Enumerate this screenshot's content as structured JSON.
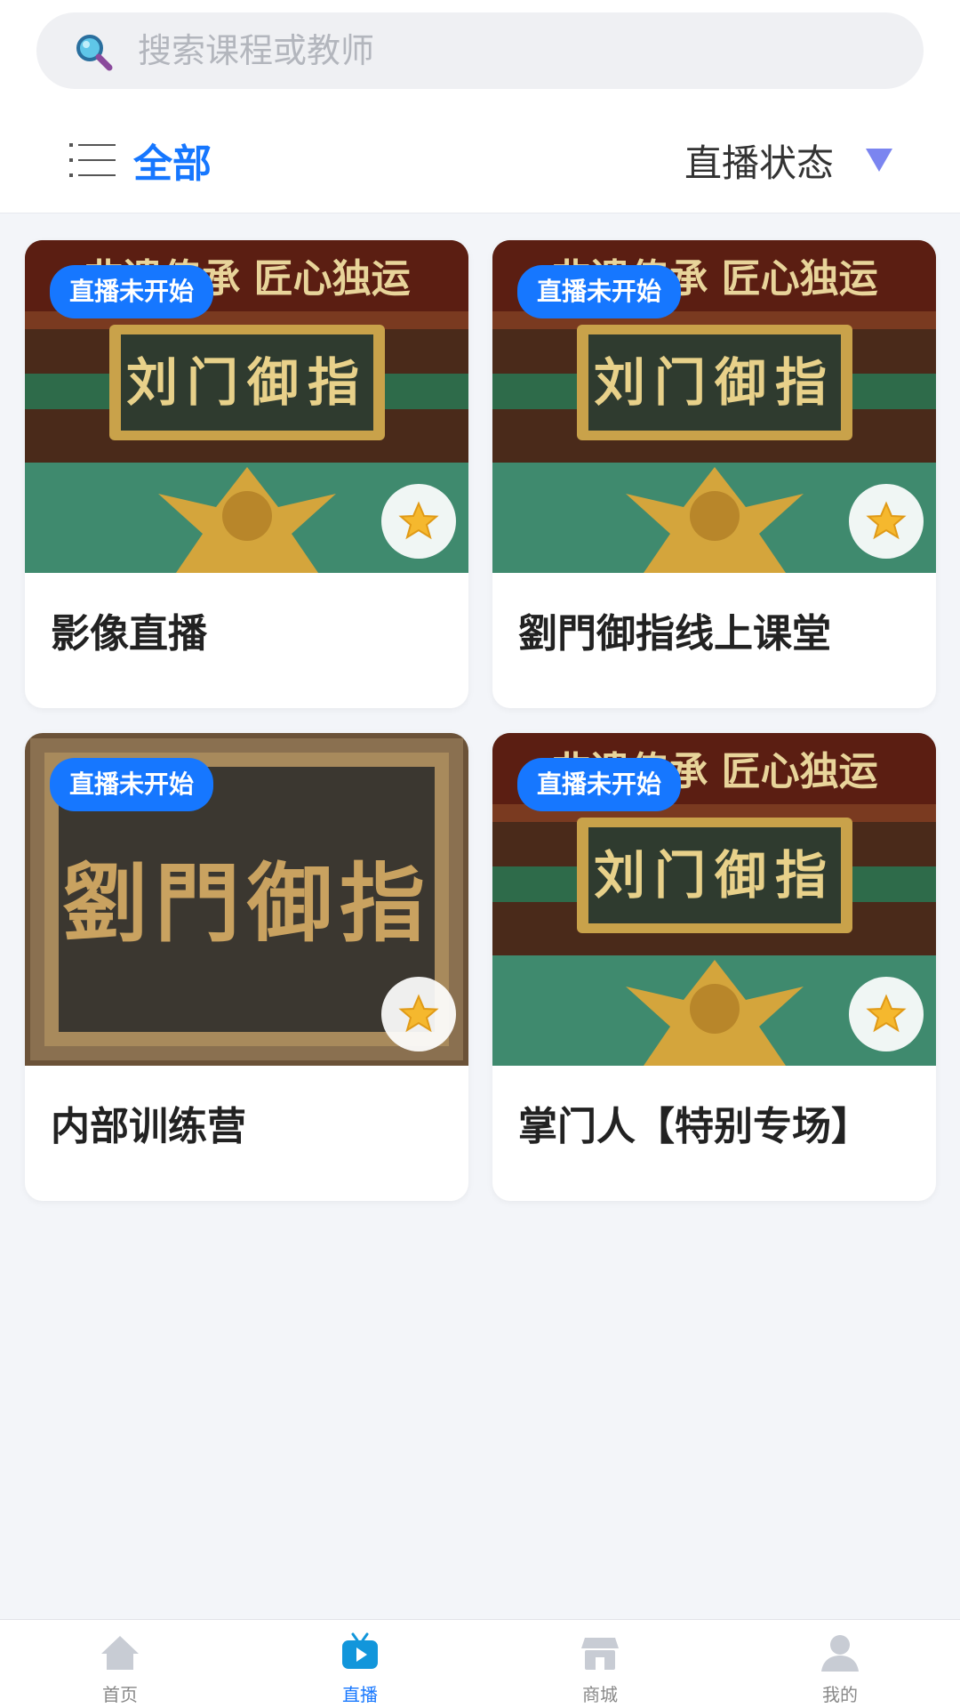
{
  "search": {
    "placeholder": "搜索课程或教师"
  },
  "filters": {
    "all_label": "全部",
    "status_label": "直播状态"
  },
  "colors": {
    "accent": "#1677ff",
    "status_arrow": "#7b85f0"
  },
  "courses": [
    {
      "title": "影像直播",
      "badge": "直播未开始",
      "image": "banner-liumen-yuzhi",
      "image_text": [
        "非遗传承 匠心独运",
        "刘门御指"
      ]
    },
    {
      "title": "劉門御指线上课堂",
      "badge": "直播未开始",
      "image": "banner-liumen-yuzhi",
      "image_text": [
        "非遗传承 匠心独运",
        "刘门御指"
      ]
    },
    {
      "title": "内部训练营",
      "badge": "直播未开始",
      "image": "plaque-liumen-yuzhi",
      "image_text": [
        "劉門御指"
      ]
    },
    {
      "title": "掌门人【特别专场】",
      "badge": "直播未开始",
      "image": "banner-liumen-yuzhi",
      "image_text": [
        "非遗传承 匠心独运",
        "刘门御指"
      ]
    }
  ],
  "tabbar": [
    {
      "label": "首页",
      "icon": "home-icon"
    },
    {
      "label": "直播",
      "icon": "live-tv-icon",
      "active": true
    },
    {
      "label": "商城",
      "icon": "store-icon"
    },
    {
      "label": "我的",
      "icon": "user-icon"
    }
  ]
}
